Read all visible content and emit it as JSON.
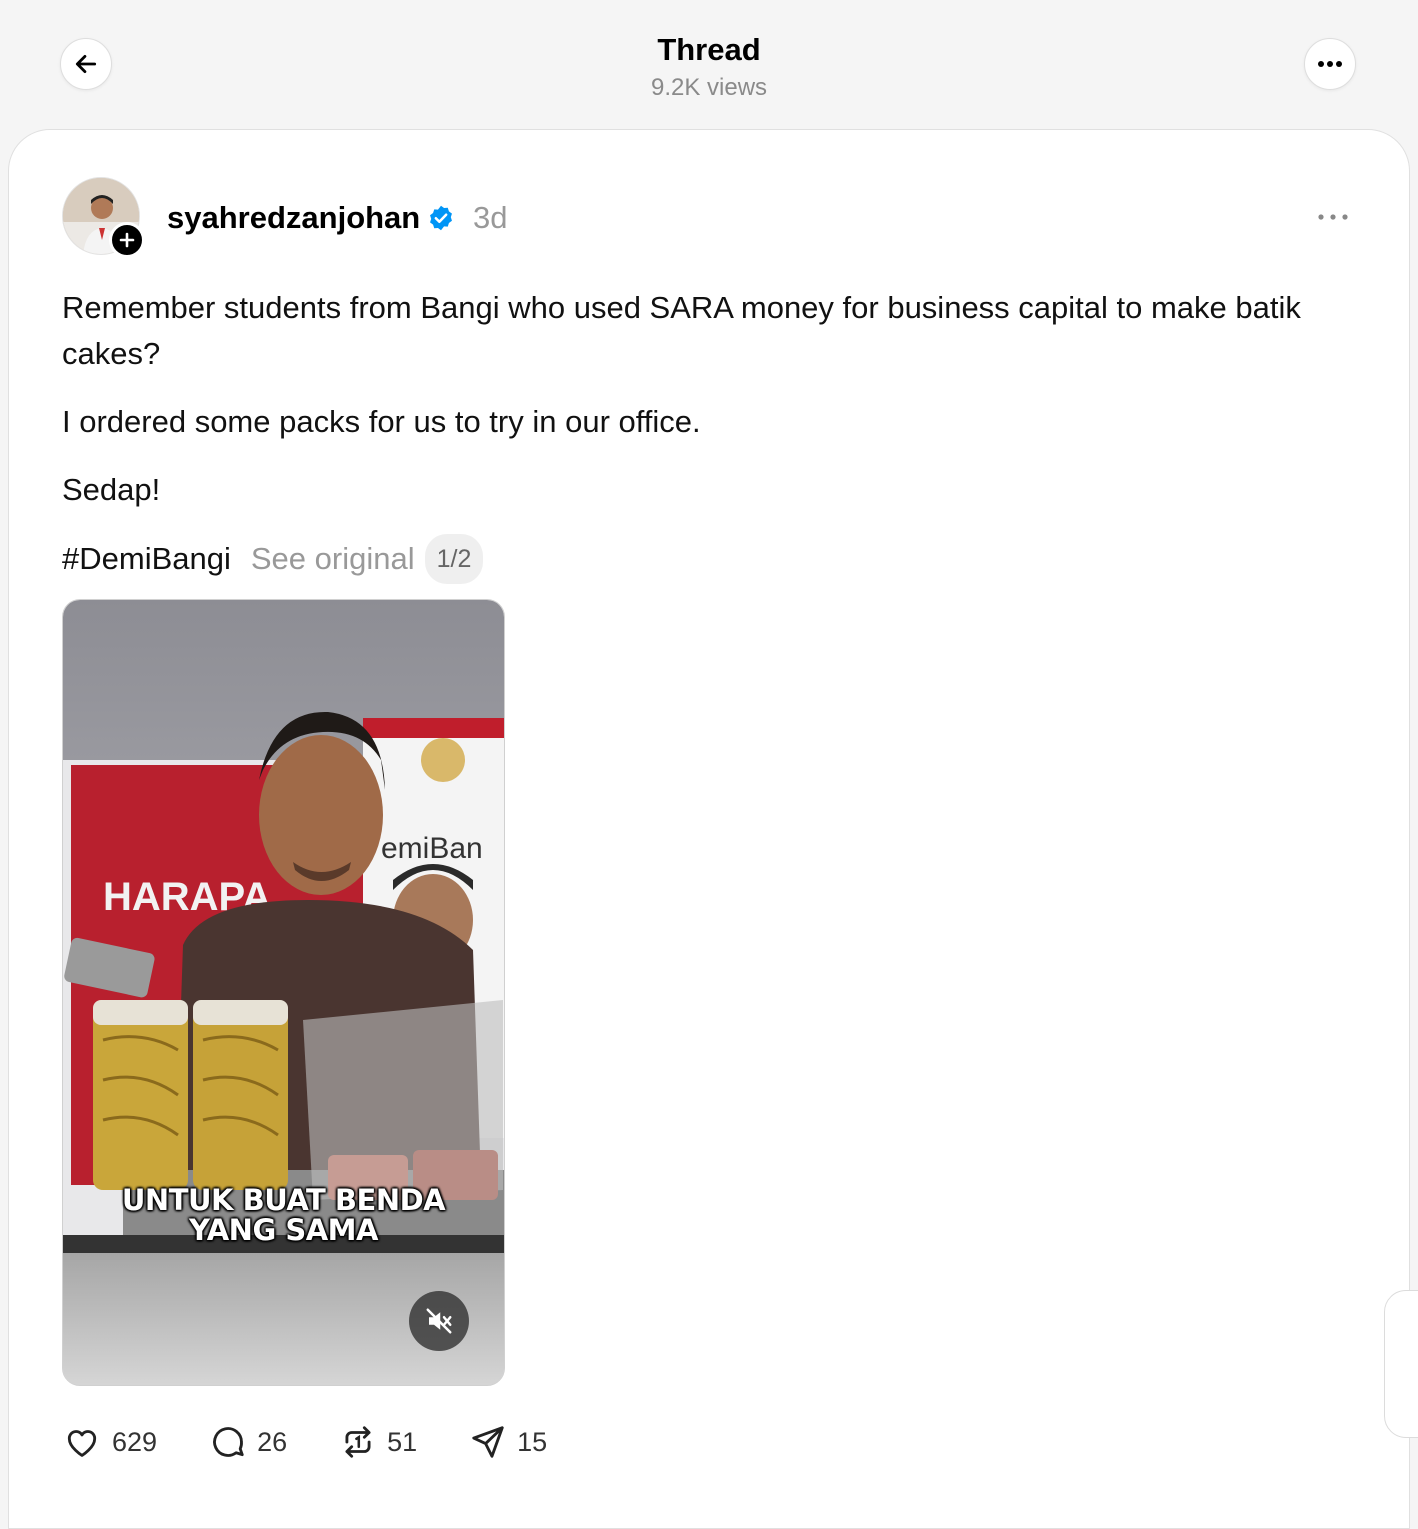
{
  "header": {
    "title": "Thread",
    "views": "9.2K views"
  },
  "post": {
    "username": "syahredzanjohan",
    "timestamp": "3d",
    "paragraphs": [
      "Remember students from Bangi who used SARA money for business capital to make batik cakes?",
      "I ordered some packs for us to try in our office.",
      "Sedap!"
    ],
    "hashtag": "#DemiBangi",
    "see_original": "See original",
    "media_counter": "1/2",
    "media": {
      "caption_line1": "UNTUK BUAT BENDA",
      "caption_line2": "YANG SAMA",
      "banner_text_left": "HARAPA",
      "banner_text_right": "emiBan"
    },
    "actions": {
      "likes": "629",
      "replies": "26",
      "reposts": "51",
      "shares": "15"
    }
  },
  "colors": {
    "verified": "#0095f6",
    "muted_text": "#999999",
    "background": "#f5f5f5"
  }
}
